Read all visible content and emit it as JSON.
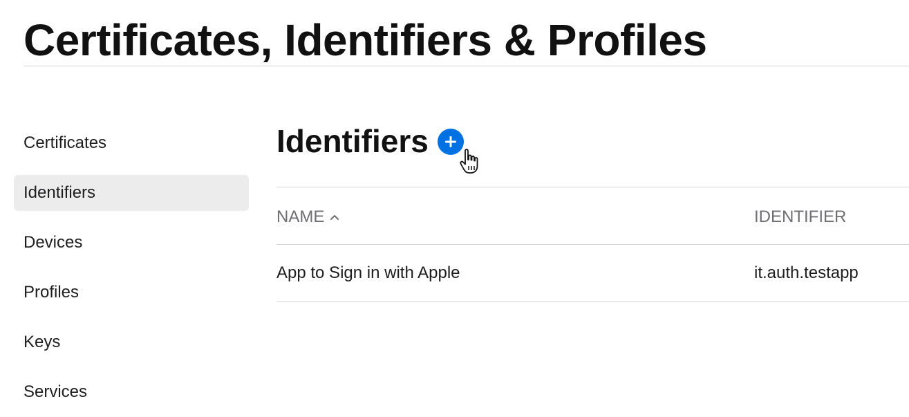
{
  "page": {
    "title": "Certificates, Identifiers & Profiles"
  },
  "sidebar": {
    "active": "Identifiers",
    "items": [
      {
        "label": "Certificates"
      },
      {
        "label": "Identifiers"
      },
      {
        "label": "Devices"
      },
      {
        "label": "Profiles"
      },
      {
        "label": "Keys"
      },
      {
        "label": "Services"
      }
    ]
  },
  "main": {
    "section_title": "Identifiers",
    "add_button": {
      "icon": "plus-circle-icon",
      "color": "#0071e3"
    },
    "table": {
      "columns": [
        {
          "label": "NAME",
          "sort": "ascending",
          "sort_icon": "chevron-up-icon"
        },
        {
          "label": "IDENTIFIER"
        }
      ],
      "rows": [
        {
          "name": "App to Sign in with Apple",
          "identifier": "it.auth.testapp"
        }
      ]
    }
  },
  "cursor": {
    "icon": "pointing-hand-cursor-icon"
  }
}
